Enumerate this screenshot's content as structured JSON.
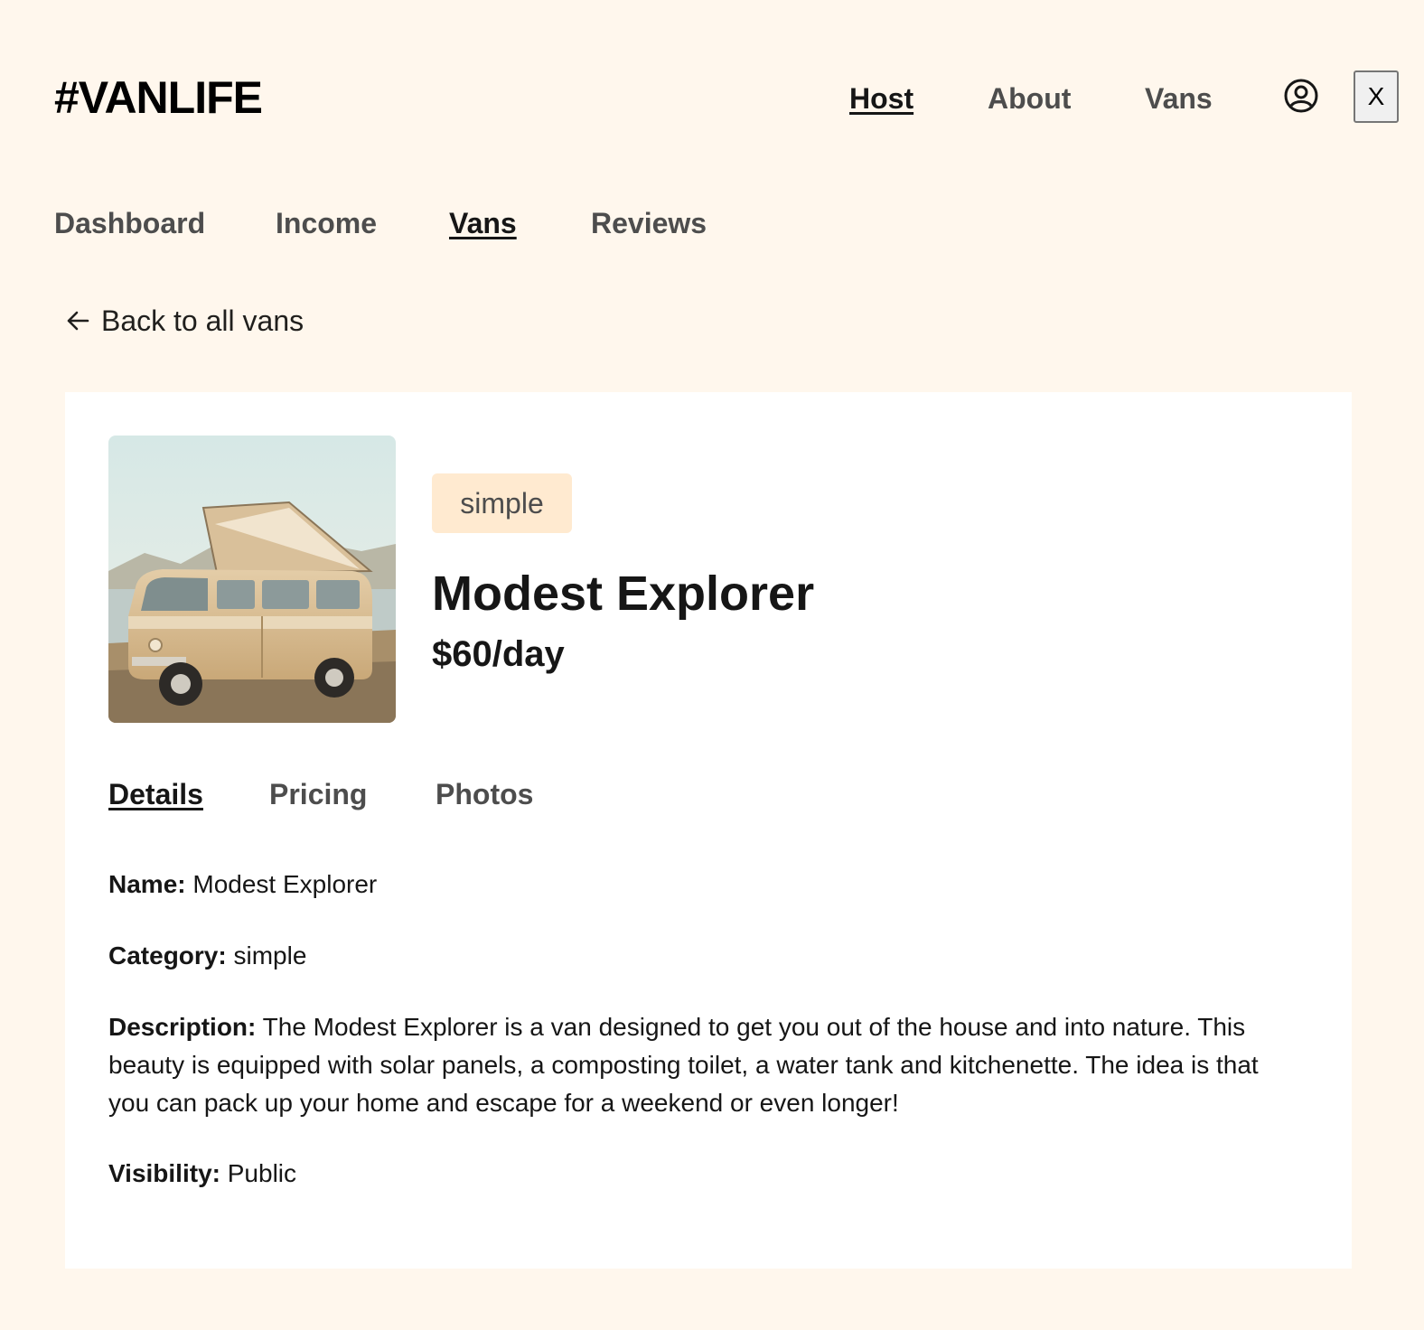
{
  "header": {
    "logo": "#VANLIFE",
    "nav": [
      {
        "label": "Host",
        "active": true
      },
      {
        "label": "About",
        "active": false
      },
      {
        "label": "Vans",
        "active": false
      }
    ],
    "user_icon": "user-circle-icon",
    "close_label": "X"
  },
  "host_nav": [
    {
      "label": "Dashboard",
      "active": false
    },
    {
      "label": "Income",
      "active": false
    },
    {
      "label": "Vans",
      "active": true
    },
    {
      "label": "Reviews",
      "active": false
    }
  ],
  "back_link": {
    "icon": "arrow-left-icon",
    "label": "Back to all vans"
  },
  "van": {
    "image": "van-photo",
    "type": "simple",
    "name": "Modest Explorer",
    "price": "$60/day"
  },
  "detail_tabs": [
    {
      "label": "Details",
      "active": true
    },
    {
      "label": "Pricing",
      "active": false
    },
    {
      "label": "Photos",
      "active": false
    }
  ],
  "details": {
    "name_label": "Name:",
    "name_value": "Modest Explorer",
    "category_label": "Category:",
    "category_value": "simple",
    "description_label": "Description:",
    "description_value": "The Modest Explorer is a van designed to get you out of the house and into nature. This beauty is equipped with solar panels, a composting toilet, a water tank and kitchenette. The idea is that you can pack up your home and escape for a weekend or even longer!",
    "visibility_label": "Visibility:",
    "visibility_value": "Public"
  },
  "colors": {
    "page_bg": "#FFF7ED",
    "badge_bg": "#FFEAD0",
    "text": "#161616",
    "muted_text": "#4D4D4D"
  }
}
